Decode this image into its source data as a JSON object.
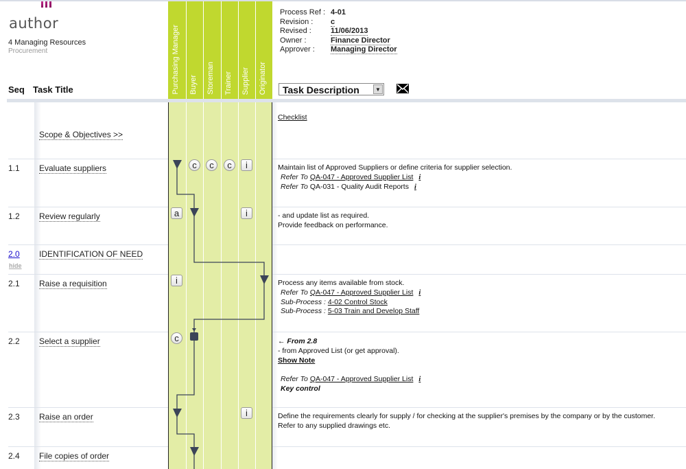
{
  "logo": {
    "text": "author"
  },
  "header": {
    "area": "4 Managing Resources",
    "process": "Procurement",
    "seq_label": "Seq",
    "task_label": "Task Title"
  },
  "lanes": [
    "Purchasing Manager",
    "Buyer",
    "Storeman",
    "Trainer",
    "Supplier",
    "Originator"
  ],
  "meta": [
    {
      "key": "Process Ref :",
      "value": "4-01"
    },
    {
      "key": "Revision :",
      "value": "c"
    },
    {
      "key": "Revised :",
      "value": "11/06/2013"
    },
    {
      "key": "Owner :",
      "value": "Finance Director"
    },
    {
      "key": "Approver :",
      "value": "Managing Director"
    }
  ],
  "view_select": {
    "value": "Task Description"
  },
  "icons": {
    "mail": "envelope-icon",
    "dropdown": "chevron-down-icon",
    "info": "info-icon"
  },
  "colors": {
    "lane_header": "#c0d82f",
    "lane_body": "#e3eda6",
    "flow": "#3b4458"
  },
  "rows": [
    {
      "seq": "",
      "task": "Scope & Objectives >>"
    },
    {
      "seq": "1.1",
      "task": "Evaluate suppliers"
    },
    {
      "seq": "1.2",
      "task": "Review regularly"
    },
    {
      "seq": "2.0",
      "task": "IDENTIFICATION OF NEED",
      "hide": "hide"
    },
    {
      "seq": "2.1",
      "task": "Raise a requisition"
    },
    {
      "seq": "2.2",
      "task": "Select a supplier"
    },
    {
      "seq": "2.3",
      "task": "Raise an order"
    },
    {
      "seq": "2.4",
      "task": "File copies of order"
    }
  ],
  "markers": {
    "c": "c",
    "i": "i",
    "a": "a"
  },
  "desc": {
    "checklist": "Checklist",
    "r11": {
      "l1": "Maintain list of Approved Suppliers or define criteria for supplier selection.",
      "refer": "Refer To",
      "link1": "QA-047 - Approved Supplier List",
      "text2": "QA-031 - Quality Audit Reports",
      "info": "i"
    },
    "r12": {
      "l1": "- and update list as required.",
      "l2": "Provide feedback on performance."
    },
    "r21": {
      "l1": "Process any items available from stock.",
      "refer": "Refer To",
      "link1": "QA-047 - Approved Supplier List",
      "sub": "Sub-Process :",
      "sub1": "4-02 Control Stock",
      "sub2": "5-03 Train and Develop Staff",
      "info": "i"
    },
    "r22": {
      "from": "From 2.8",
      "l1": "- from Approved List (or get approval).",
      "show": "Show Note",
      "refer": "Refer To",
      "link1": "QA-047 - Approved Supplier List",
      "key": "Key control",
      "info": "i"
    },
    "r23": {
      "l1": "Define the requirements clearly for supply / for checking at the supplier's premises by the company or by the customer.",
      "l2": "Refer to any supplied drawings etc."
    }
  }
}
